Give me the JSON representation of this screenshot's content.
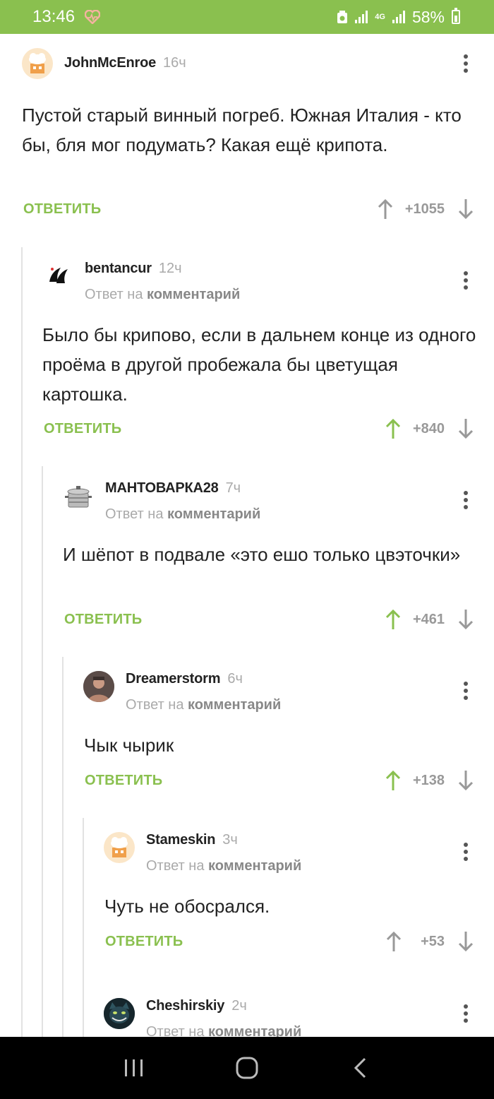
{
  "status": {
    "time": "13:46",
    "network": "4G",
    "battery": "58%"
  },
  "labels": {
    "reply_to_prefix": "Ответ на",
    "reply_to_target": "комментарий",
    "reply_button": "ОТВЕТИТЬ"
  },
  "colors": {
    "accent_green": "#8ac04f",
    "vote_gray": "#999999"
  },
  "comments": [
    {
      "user": "JohnMcEnroe",
      "time": "16ч",
      "text": "Пустой старый винный погреб. Южная Италия - кто бы, бля мог подумать? Какая ещё крипота.",
      "score": "+1055",
      "upvoted": false,
      "avatar": "chef-hat-avatar"
    },
    {
      "user": "bentancur",
      "time": "12ч",
      "text": "Было бы крипово, если в дальнем конце из одного проёма в другой пробежала бы цветущая картошка.",
      "score": "+840",
      "upvoted": true,
      "avatar": "black-logo-avatar"
    },
    {
      "user": "МАНТОВАРКА28",
      "time": "7ч",
      "text": "И шёпот в подвале «это ешо только цвэточки»",
      "score": "+461",
      "upvoted": true,
      "avatar": "steamer-pot-avatar"
    },
    {
      "user": "Dreamerstorm",
      "time": "6ч",
      "text": "Чык чырик",
      "score": "+138",
      "upvoted": true,
      "avatar": "person-photo-avatar"
    },
    {
      "user": "Stameskin",
      "time": "3ч",
      "text": "Чуть не обосрался.",
      "score": "+53",
      "upvoted": false,
      "avatar": "chef-hat-avatar"
    },
    {
      "user": "Cheshirskiy",
      "time": "2ч",
      "text": "",
      "score": "",
      "upvoted": false,
      "avatar": "cheshire-cat-avatar"
    }
  ]
}
